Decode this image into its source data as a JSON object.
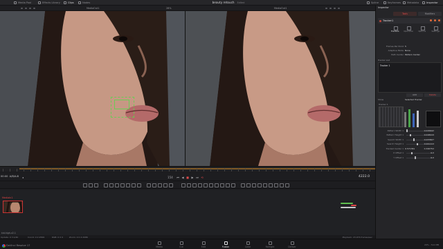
{
  "topbar": {
    "items": [
      "Media Pool",
      "Effects Library",
      "Clips",
      "Nodes"
    ],
    "right_items": [
      "Spline",
      "Keyframes",
      "Metadata",
      "Inspector"
    ],
    "title": "beauty retouch",
    "subtitle": "Edited"
  },
  "viewer": {
    "left_label": "MediaOut1",
    "right_label": "MediaOut1",
    "zoom": "28%"
  },
  "transport": {
    "timecode_left": "00:00",
    "timecode_left2": "A/B/A-B",
    "frame": "4222.0",
    "center_count": "154"
  },
  "flow": {
    "clip_label": "MediaIn1",
    "clip_name": "kid-high-v2.1"
  },
  "status": {
    "items": [
      "Update: 9 3 2/40",
      "Coord: 0 2:2566",
      "RGB: 0 0 0",
      "Zoom: 0 0 2:2086"
    ],
    "right": "Playback: 23.976 frames/sec"
  },
  "pages": [
    {
      "label": "Media",
      "active": false
    },
    {
      "label": "Cut",
      "active": false
    },
    {
      "label": "Edit",
      "active": false
    },
    {
      "label": "Fusion",
      "active": true
    },
    {
      "label": "Color",
      "active": false
    },
    {
      "label": "Fairlight",
      "active": false
    },
    {
      "label": "Deliver",
      "active": false
    }
  ],
  "app": {
    "name": "DaVinci Resolve 17"
  },
  "pagebar_right": "29% - 512 MB",
  "inspector": {
    "title": "Inspector",
    "tabs": [
      "Tools",
      "Modifiers"
    ],
    "node_name": "Tracker1",
    "subtabs": [
      "Trackers",
      "Operation",
      "Options",
      "Settings"
    ],
    "params": [
      {
        "label": "Frames Per Point",
        "value": "5"
      },
      {
        "label": "Adaptive Mode",
        "value": "None"
      },
      {
        "label": "Path Center",
        "value": "Pattern Center"
      }
    ],
    "tracker_list_label": "Tracker List",
    "tracker_item": "Tracker 1",
    "add_label": "Add",
    "delete_label": "Delete",
    "show_label": "Show",
    "show_value": "Selected Tracker",
    "tracker_section": "Tracker 1",
    "rows": [
      {
        "label": "Pattern Width 1",
        "num": "0.015642"
      },
      {
        "label": "Pattern Height 1",
        "num": "0.018219"
      },
      {
        "label": "Search Width 1",
        "num": "0.037827"
      },
      {
        "label": "Search Height 1",
        "num": "0.041114"
      },
      {
        "label": "Tracked Center 1",
        "num": "0.346752",
        "extra": "0.571361"
      },
      {
        "label": "X Offset 1",
        "num": "0.0"
      },
      {
        "label": "Y Offset 1",
        "num": "0.0"
      }
    ]
  }
}
